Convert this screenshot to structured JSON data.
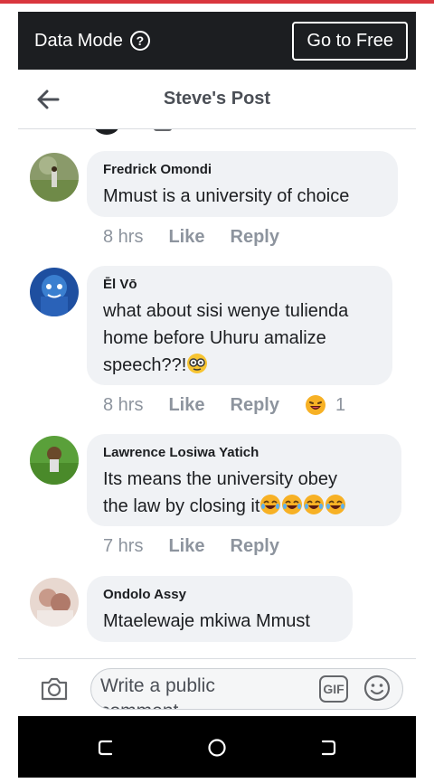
{
  "data_mode": {
    "label": "Data Mode",
    "help_glyph": "?",
    "go_free": "Go to Free"
  },
  "header": {
    "title": "Steve's Post"
  },
  "comments": [
    {
      "author": "Fredrick Omondi",
      "lines": [
        "Mmust is a university of choice"
      ],
      "time": "8 hrs",
      "like": "Like",
      "reply": "Reply"
    },
    {
      "author": "Ēl Vō",
      "lines": [
        "what about sisi wenye tulienda",
        "home before Uhuru amalize",
        "speech??!"
      ],
      "time": "8 hrs",
      "like": "Like",
      "reply": "Reply",
      "reaction": {
        "icon": "laughing-emoji",
        "count": "1"
      }
    },
    {
      "author": "Lawrence Losiwa Yatich",
      "lines": [
        "Its means the university obey",
        "the law by closing it"
      ],
      "time": "7 hrs",
      "like": "Like",
      "reply": "Reply"
    },
    {
      "author": "Ondolo Assy",
      "lines": [
        "Mtaelewaje mkiwa Mmust"
      ]
    }
  ],
  "composer": {
    "placeholder_line1": "Write a public",
    "placeholder_line2": "comment",
    "gif": "GIF"
  },
  "colors": {
    "bar": "#1c1e21",
    "bubble": "#f0f2f5",
    "meta": "#8d949e",
    "accent_top": "#d9363e"
  }
}
